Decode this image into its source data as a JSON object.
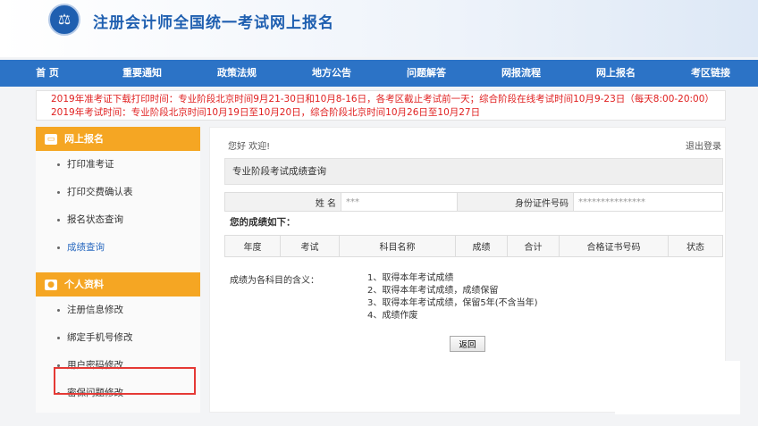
{
  "header": {
    "logo_glyph": "⚖",
    "title": "注册会计师全国统一考试网上报名"
  },
  "nav": {
    "items": [
      "首 页",
      "重要通知",
      "政策法规",
      "地方公告",
      "问题解答",
      "网报流程",
      "网上报名",
      "考区链接"
    ]
  },
  "notice": {
    "lines": [
      "2019年准考证下载打印时间：专业阶段北京时间9月21-30日和10月8-16日，各考区截止考试前一天；综合阶段在线考试时间10月9-23日（每天8:00-20:00）",
      "2019年考试时间：专业阶段北京时间10月19日至10月20日，综合阶段北京时间10月26日至10月27日"
    ]
  },
  "sidebar": {
    "online_header": "网上报名",
    "online_items": [
      "打印准考证",
      "打印交费确认表",
      "报名状态查询",
      "成绩查询"
    ],
    "active_item": "成绩查询",
    "profile_header": "个人资料",
    "profile_items": [
      "注册信息修改",
      "绑定手机号修改",
      "用户密码修改",
      "密保问题修改"
    ]
  },
  "main": {
    "welcome": "您好 欢迎!",
    "logout": "退出登录",
    "query_title": "专业阶段考试成绩查询",
    "info": {
      "name_label": "姓 名",
      "name_value": "***",
      "id_label": "身份证件号码",
      "id_value": "***************"
    },
    "results_title": "您的成绩如下：",
    "columns": [
      "年度",
      "考试",
      "科目名称",
      "成绩",
      "合计",
      "合格证书号码",
      "状态"
    ],
    "legend_label": "成绩为各科目的含义：",
    "legend_items": [
      "1、取得本年考试成绩",
      "2、取得本年考试成绩，成绩保留",
      "3、取得本年考试成绩，保留5年(不含当年)",
      "4、成绩作废"
    ],
    "return_button": "返回"
  }
}
